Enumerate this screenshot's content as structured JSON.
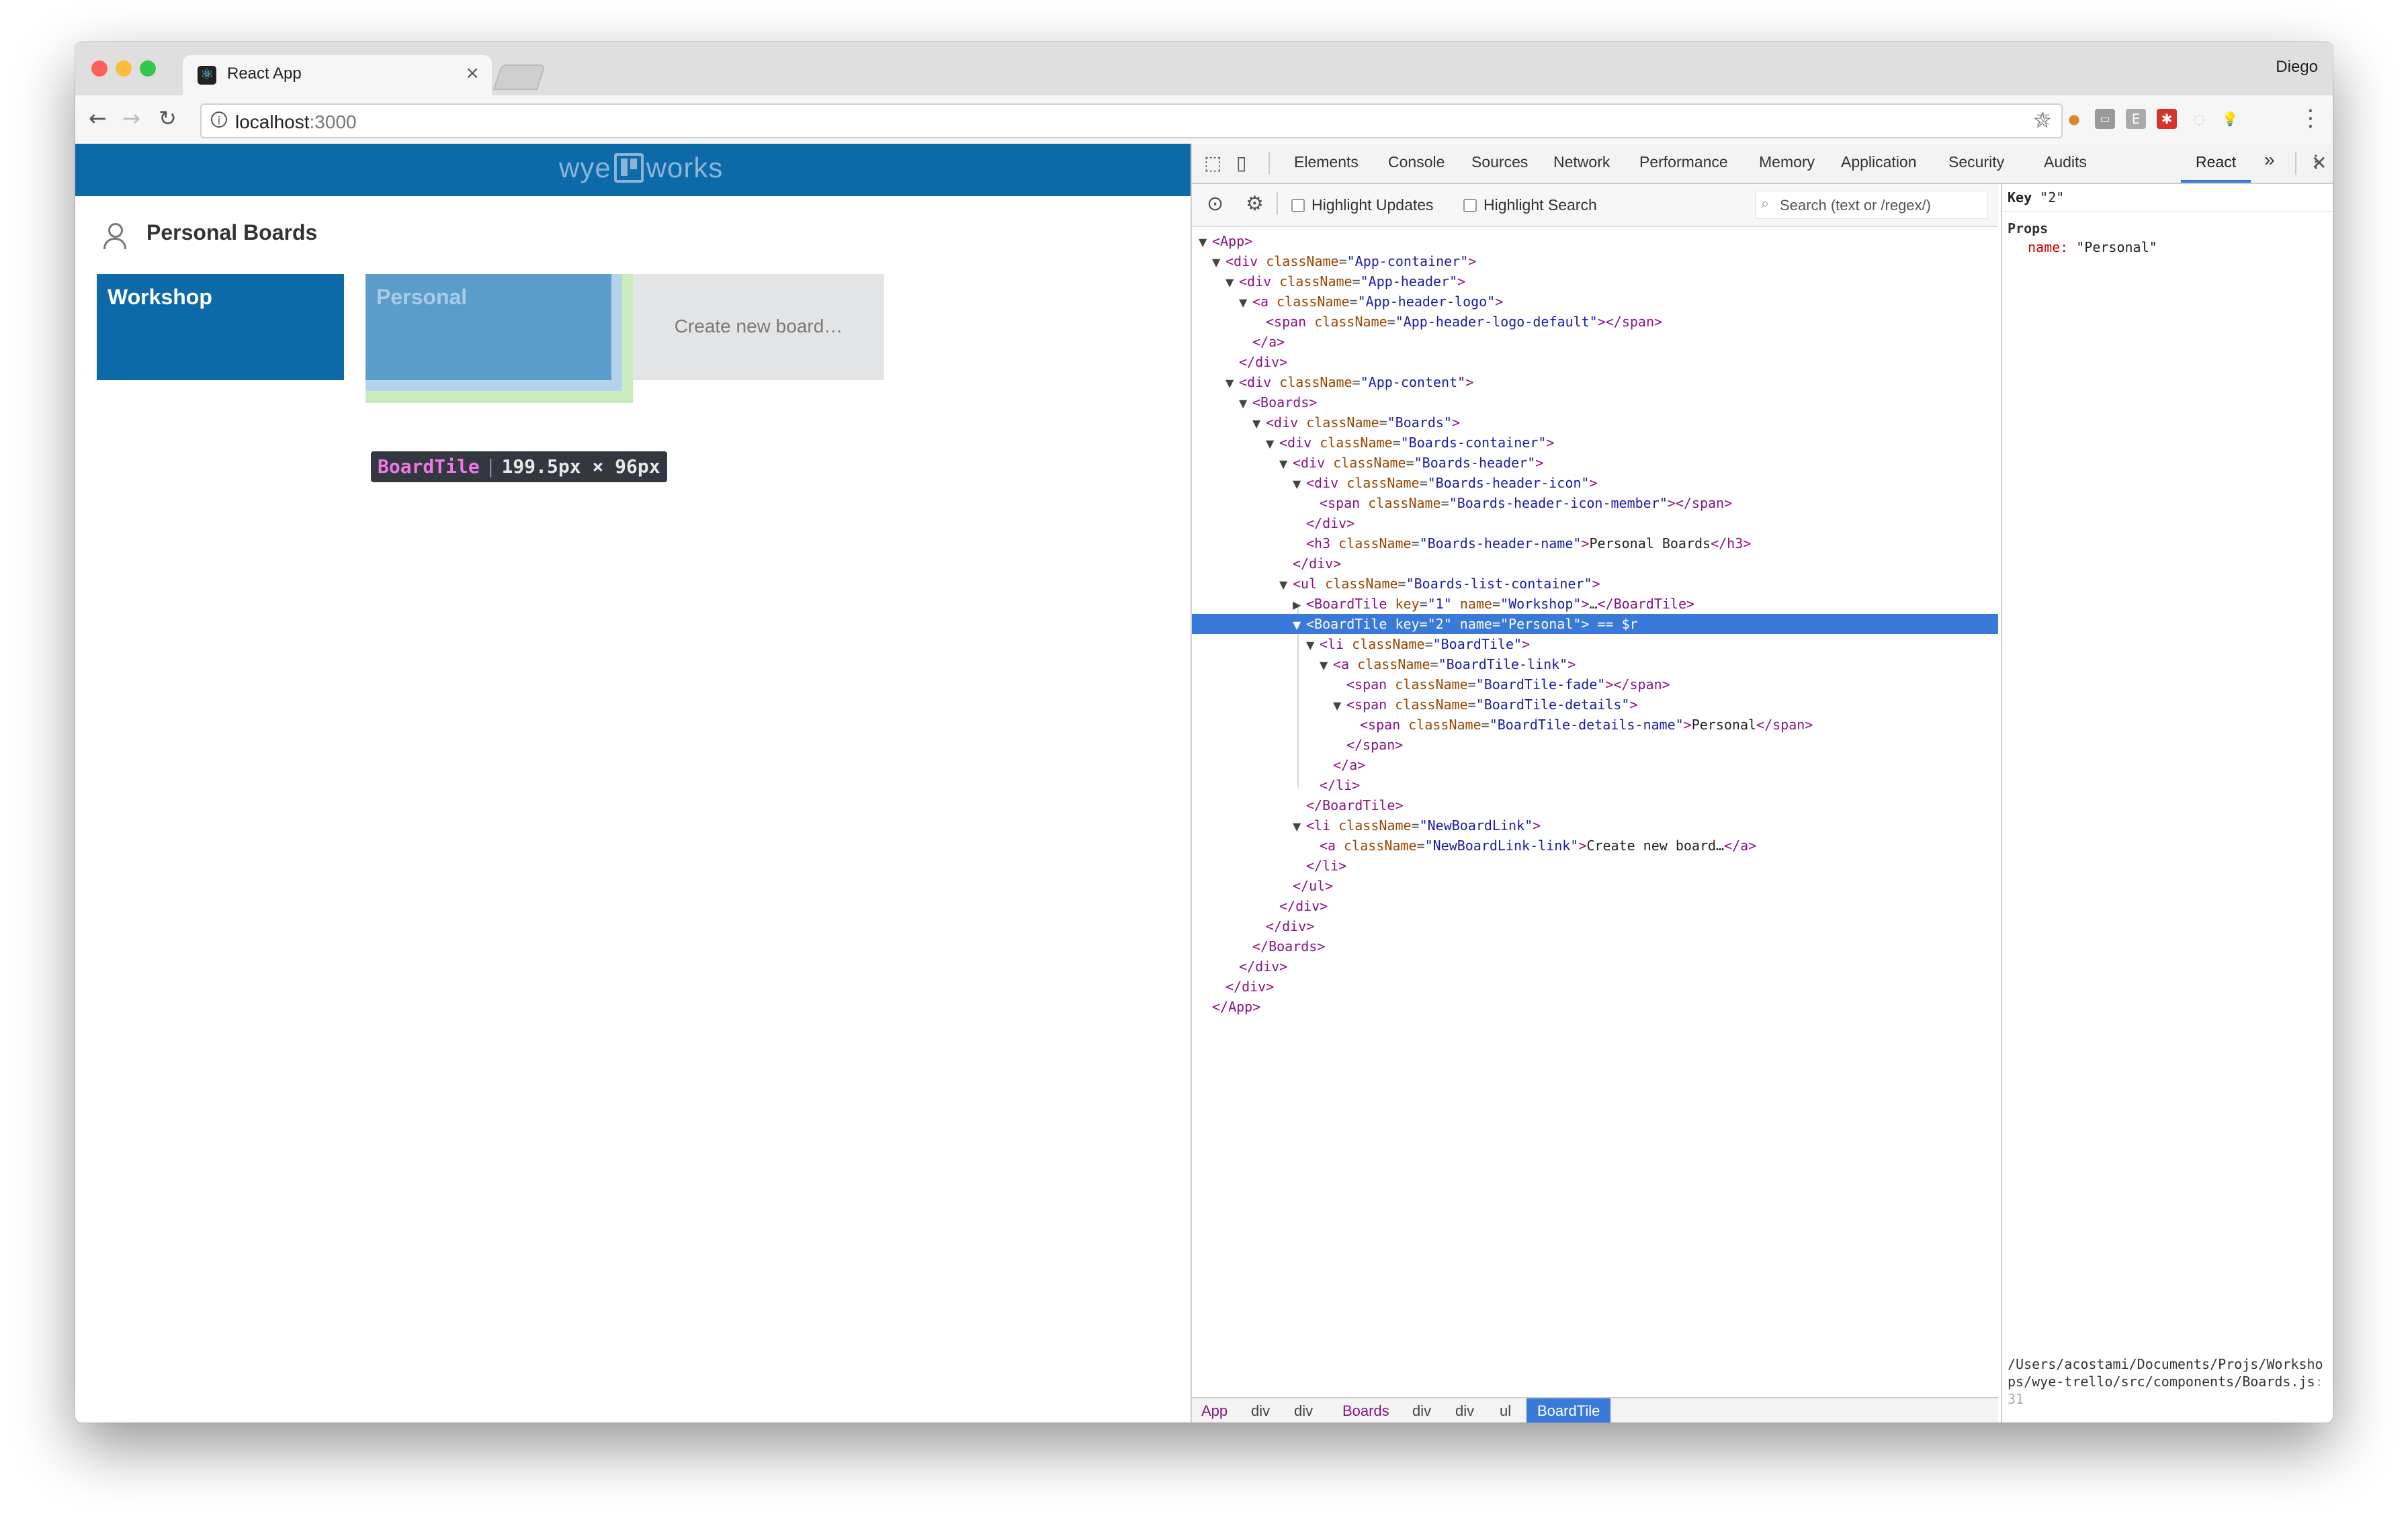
{
  "browser": {
    "tab_title": "React App",
    "tab_close": "×",
    "profile_name": "Diego",
    "url_host": "localhost",
    "url_port": ":3000"
  },
  "app": {
    "logo_left": "wye",
    "logo_right": "works",
    "boards_title": "Personal Boards",
    "tiles": [
      {
        "name": "Workshop"
      },
      {
        "name": "Personal"
      }
    ],
    "new_board_label": "Create new board…",
    "highlight_tooltip": {
      "component": "BoardTile",
      "dimensions": "199.5px × 96px"
    }
  },
  "devtools": {
    "tabs": [
      "Elements",
      "Console",
      "Sources",
      "Network",
      "Performance",
      "Memory",
      "Application",
      "Security",
      "Audits",
      "React"
    ],
    "active_tab": "React",
    "more_tabs": "»",
    "toolbar": {
      "highlight_updates": "Highlight Updates",
      "highlight_search": "Highlight Search",
      "search_placeholder": "Search (text or /regex/)"
    },
    "breadcrumbs": [
      "App",
      "div",
      "div",
      "Boards",
      "div",
      "div",
      "ul",
      "BoardTile"
    ],
    "side": {
      "key_label": "Key",
      "key_value": "\"2\"",
      "props_label": "Props",
      "prop_name": "name:",
      "prop_value": "\"Personal\"",
      "source_path": "/Users/acostami/Documents/Projs/Workshops/wye-trello/src/components/Boards.js",
      "source_line": ":31"
    }
  },
  "colors": {
    "header_blue": "#0d6aa8",
    "selection_blue": "#3879d9",
    "tag_purple": "#881280",
    "attr_name": "#994500",
    "attr_value": "#1a1aa6"
  }
}
